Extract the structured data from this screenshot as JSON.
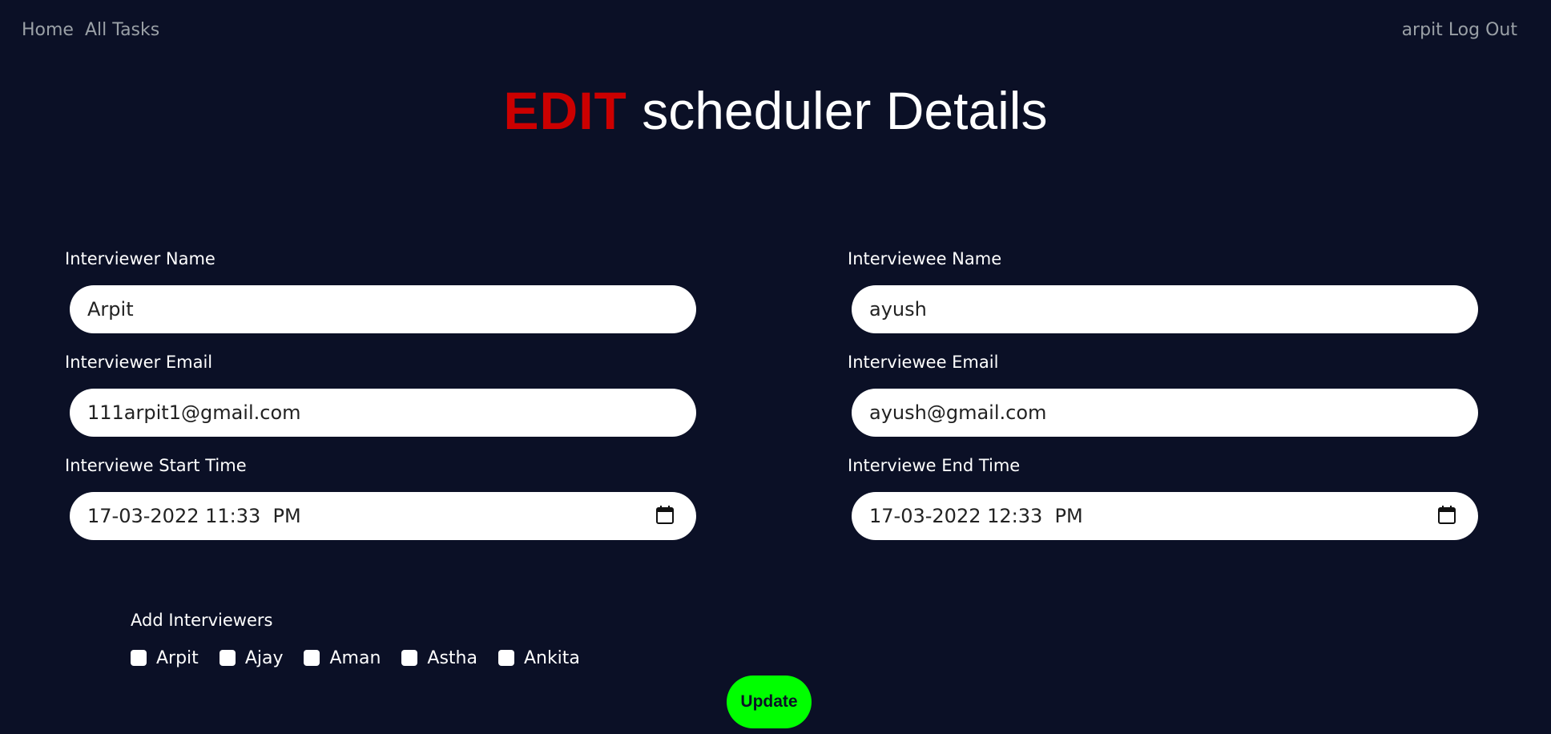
{
  "nav": {
    "home": "Home",
    "all_tasks": "All Tasks",
    "user": "arpit",
    "logout": "Log Out"
  },
  "title": {
    "edit": "EDIT",
    "rest": "scheduler Details"
  },
  "form": {
    "interviewer_name": {
      "label": "Interviewer Name",
      "value": "Arpit"
    },
    "interviewee_name": {
      "label": "Interviewee Name",
      "value": "ayush"
    },
    "interviewer_email": {
      "label": "Interviewer Email",
      "value": "111arpit1@gmail.com"
    },
    "interviewee_email": {
      "label": "Interviewee Email",
      "value": "ayush@gmail.com"
    },
    "start_time": {
      "label": "Interviewe Start Time",
      "value": "17-03-2022 11:33  PM"
    },
    "end_time": {
      "label": "Interviewe End Time",
      "value": "17-03-2022 12:33  PM"
    }
  },
  "add_interviewers": {
    "label": "Add Interviewers",
    "options": [
      {
        "label": "Arpit",
        "checked": false
      },
      {
        "label": "Ajay",
        "checked": false
      },
      {
        "label": "Aman",
        "checked": false
      },
      {
        "label": "Astha",
        "checked": false
      },
      {
        "label": "Ankita",
        "checked": false
      }
    ]
  },
  "update_button": "Update",
  "icons": {
    "calendar": "calendar-icon"
  },
  "colors": {
    "background": "#0b1026",
    "edit_accent": "#cc0000",
    "update_button": "#00ff00"
  }
}
